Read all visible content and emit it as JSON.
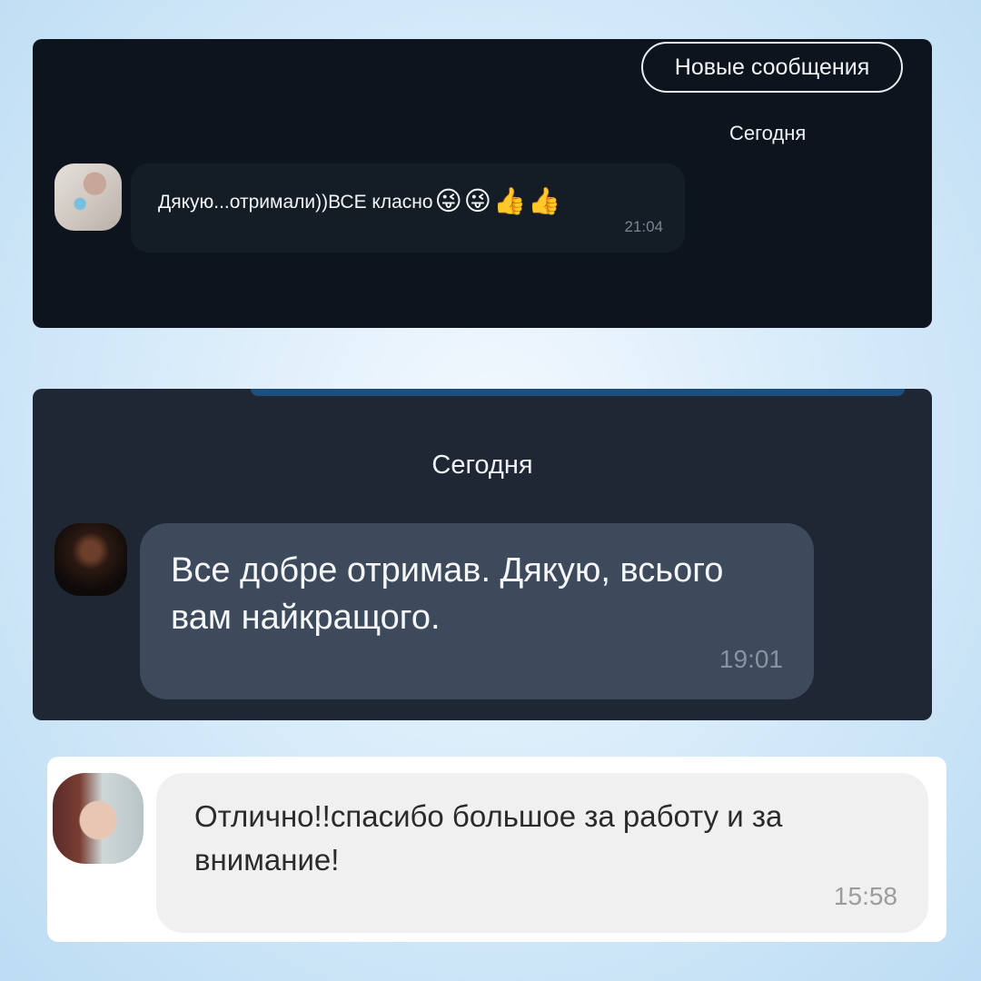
{
  "panel1": {
    "new_messages_label": "Новые сообщения",
    "date_label": "Сегодня",
    "message": {
      "text": "Дякую...отримали))ВСЕ класно",
      "emojis": [
        "😜",
        "😜",
        "👍",
        "👍"
      ],
      "time": "21:04"
    }
  },
  "panel2": {
    "date_label": "Сегодня",
    "message": {
      "text": "Все добре отримав. Дякую, всього вам найкращого.",
      "time": "19:01"
    }
  },
  "panel3": {
    "message": {
      "text": "Отлично!!спасибо большое за работу и за внимание!",
      "time": "15:58"
    }
  },
  "colors": {
    "panel1_bg": "#0d141d",
    "panel2_bg": "#1e2733",
    "panel2_bubble": "#3d4a5c",
    "panel3_bubble": "#f0f0f0"
  }
}
